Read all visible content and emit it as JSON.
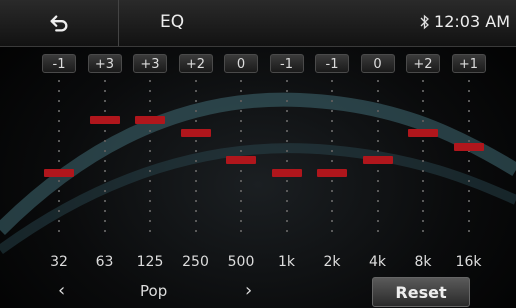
{
  "header": {
    "title": "EQ",
    "time": "12:03 AM"
  },
  "icons": {
    "back": "back-arrow-icon",
    "bluetooth": "bluetooth-icon",
    "prev": "chevron-left-icon",
    "next": "chevron-right-icon"
  },
  "colors": {
    "handle": "#b0161c",
    "background": "#000000",
    "text": "#dddddd"
  },
  "eq": {
    "range": [
      -6,
      6
    ],
    "bands": [
      {
        "freq": "32",
        "value_label": "-1",
        "value": -1
      },
      {
        "freq": "63",
        "value_label": "+3",
        "value": 3
      },
      {
        "freq": "125",
        "value_label": "+3",
        "value": 3
      },
      {
        "freq": "250",
        "value_label": "+2",
        "value": 2
      },
      {
        "freq": "500",
        "value_label": "0",
        "value": 0
      },
      {
        "freq": "1k",
        "value_label": "-1",
        "value": -1
      },
      {
        "freq": "2k",
        "value_label": "-1",
        "value": -1
      },
      {
        "freq": "4k",
        "value_label": "0",
        "value": 0
      },
      {
        "freq": "8k",
        "value_label": "+2",
        "value": 2
      },
      {
        "freq": "16k",
        "value_label": "+1",
        "value": 1
      }
    ]
  },
  "preset": {
    "prev_label": "‹",
    "label": "Pop",
    "next_label": "›"
  },
  "reset_label": "Reset"
}
